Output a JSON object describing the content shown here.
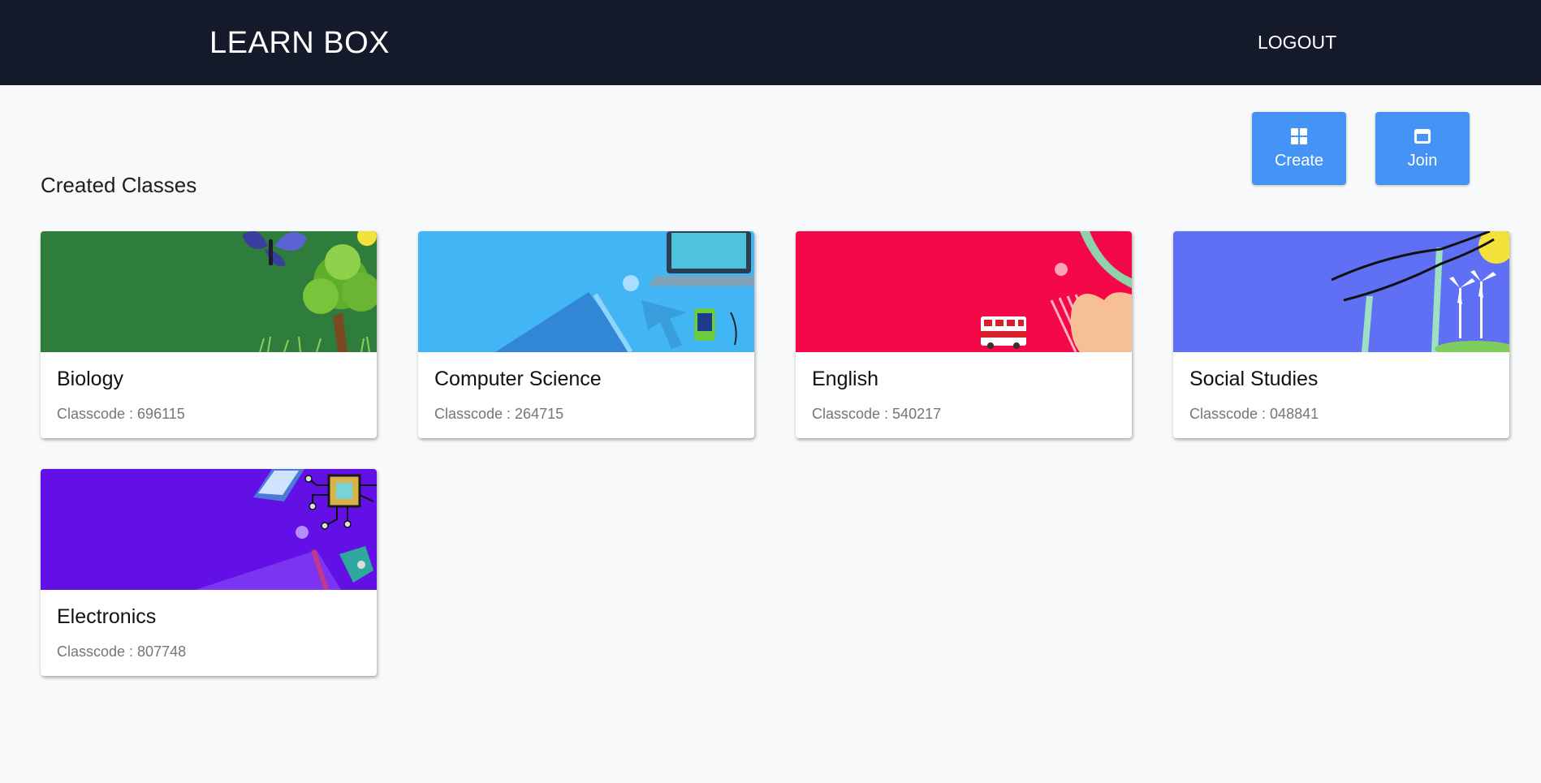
{
  "header": {
    "brand": "LEARN BOX",
    "logout_label": "LOGOUT"
  },
  "actions": {
    "create_label": "Create",
    "join_label": "Join",
    "create_icon": "grid-icon",
    "join_icon": "window-icon",
    "button_color": "#4593f4"
  },
  "section": {
    "title": "Created Classes"
  },
  "classes": [
    {
      "name": "Biology",
      "code_text": "Classcode : 696115",
      "banner_color": "#2e7d3c",
      "banner_art": "nature"
    },
    {
      "name": "Computer Science",
      "code_text": "Classcode : 264715",
      "banner_color": "#42b6f4",
      "banner_art": "laptop"
    },
    {
      "name": "English",
      "code_text": "Classcode : 540217",
      "banner_color": "#f50847",
      "banner_art": "london-bus"
    },
    {
      "name": "Social Studies",
      "code_text": "Classcode : 048841",
      "banner_color": "#5f70f5",
      "banner_art": "power-lines"
    },
    {
      "name": "Electronics",
      "code_text": "Classcode : 807748",
      "banner_color": "#6210e6",
      "banner_art": "circuit-chip"
    }
  ]
}
